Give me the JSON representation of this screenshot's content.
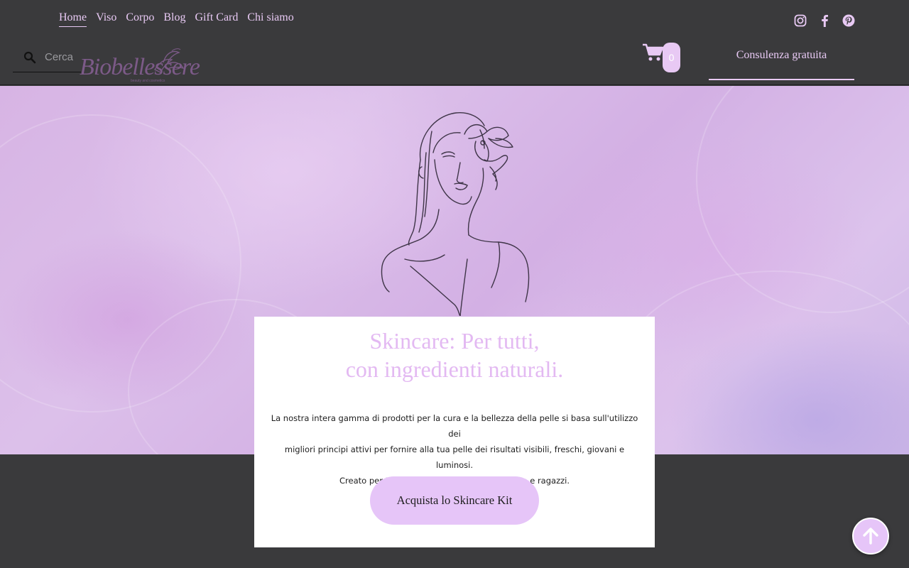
{
  "nav": {
    "items": [
      {
        "label": "Home",
        "active": true
      },
      {
        "label": "Viso"
      },
      {
        "label": "Corpo"
      },
      {
        "label": "Blog"
      },
      {
        "label": "Gift Card"
      },
      {
        "label": "Chi siamo"
      }
    ]
  },
  "social": {
    "icons": [
      "instagram-icon",
      "facebook-icon",
      "pinterest-icon"
    ]
  },
  "search": {
    "placeholder": "Cerca"
  },
  "logo": {
    "text": "Biobellessere",
    "subtext": "beauty and cosmetics"
  },
  "cart": {
    "count": "0"
  },
  "header": {
    "cta_label": "Consulenza gratuita"
  },
  "hero": {
    "title_line1": "Skincare: Per tutti,",
    "title_line2": "con ingredienti naturali.",
    "description_line1": "La nostra intera gamma di prodotti per la cura e la bellezza della pelle si basa sull'utilizzo dei",
    "description_line2": "migliori principi attivi per fornire alla tua pelle dei risultati visibili, freschi, giovani e luminosi.",
    "description_line3": "Creato per tutti i generi di pelle, donna, uomo e ragazzi.",
    "button_label": "Acquista lo Skincare Kit"
  },
  "colors": {
    "accent": "#e8c9f4",
    "header_bg": "#3a3a3c",
    "button_bg": "#e6c5f8",
    "title": "#e3b9f2"
  }
}
